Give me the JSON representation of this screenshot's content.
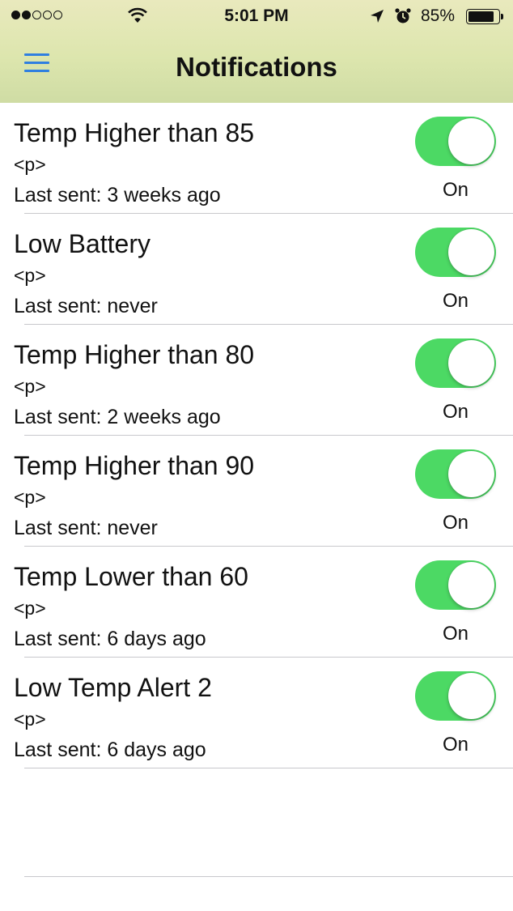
{
  "status_bar": {
    "time": "5:01 PM",
    "battery_percent": "85%",
    "signal_filled": 2,
    "signal_total": 5,
    "icons": [
      "signal-dots-icon",
      "wifi-icon",
      "location-arrow-icon",
      "alarm-clock-icon",
      "battery-icon"
    ]
  },
  "navbar": {
    "title": "Notifications",
    "menu_icon": "hamburger-menu-icon",
    "menu_color": "#2f7fe0"
  },
  "colors": {
    "toggle_on": "#4cd964",
    "header_gradient_top": "#e9e9bd",
    "header_gradient_bottom": "#cfdca4"
  },
  "notifications": [
    {
      "title": "Temp Higher than 85",
      "subtitle": "<p>",
      "last_sent": "Last sent: 3 weeks ago",
      "enabled": true,
      "state_label": "On"
    },
    {
      "title": "Low Battery",
      "subtitle": "<p>",
      "last_sent": "Last sent: never",
      "enabled": true,
      "state_label": "On"
    },
    {
      "title": "Temp Higher than 80",
      "subtitle": "<p>",
      "last_sent": "Last sent: 2 weeks ago",
      "enabled": true,
      "state_label": "On"
    },
    {
      "title": "Temp Higher than 90",
      "subtitle": "<p>",
      "last_sent": "Last sent: never",
      "enabled": true,
      "state_label": "On"
    },
    {
      "title": "Temp Lower than 60",
      "subtitle": "<p>",
      "last_sent": "Last sent: 6 days ago",
      "enabled": true,
      "state_label": "On"
    },
    {
      "title": "Low Temp Alert 2",
      "subtitle": "<p>",
      "last_sent": "Last sent: 6 days ago",
      "enabled": true,
      "state_label": "On"
    }
  ]
}
